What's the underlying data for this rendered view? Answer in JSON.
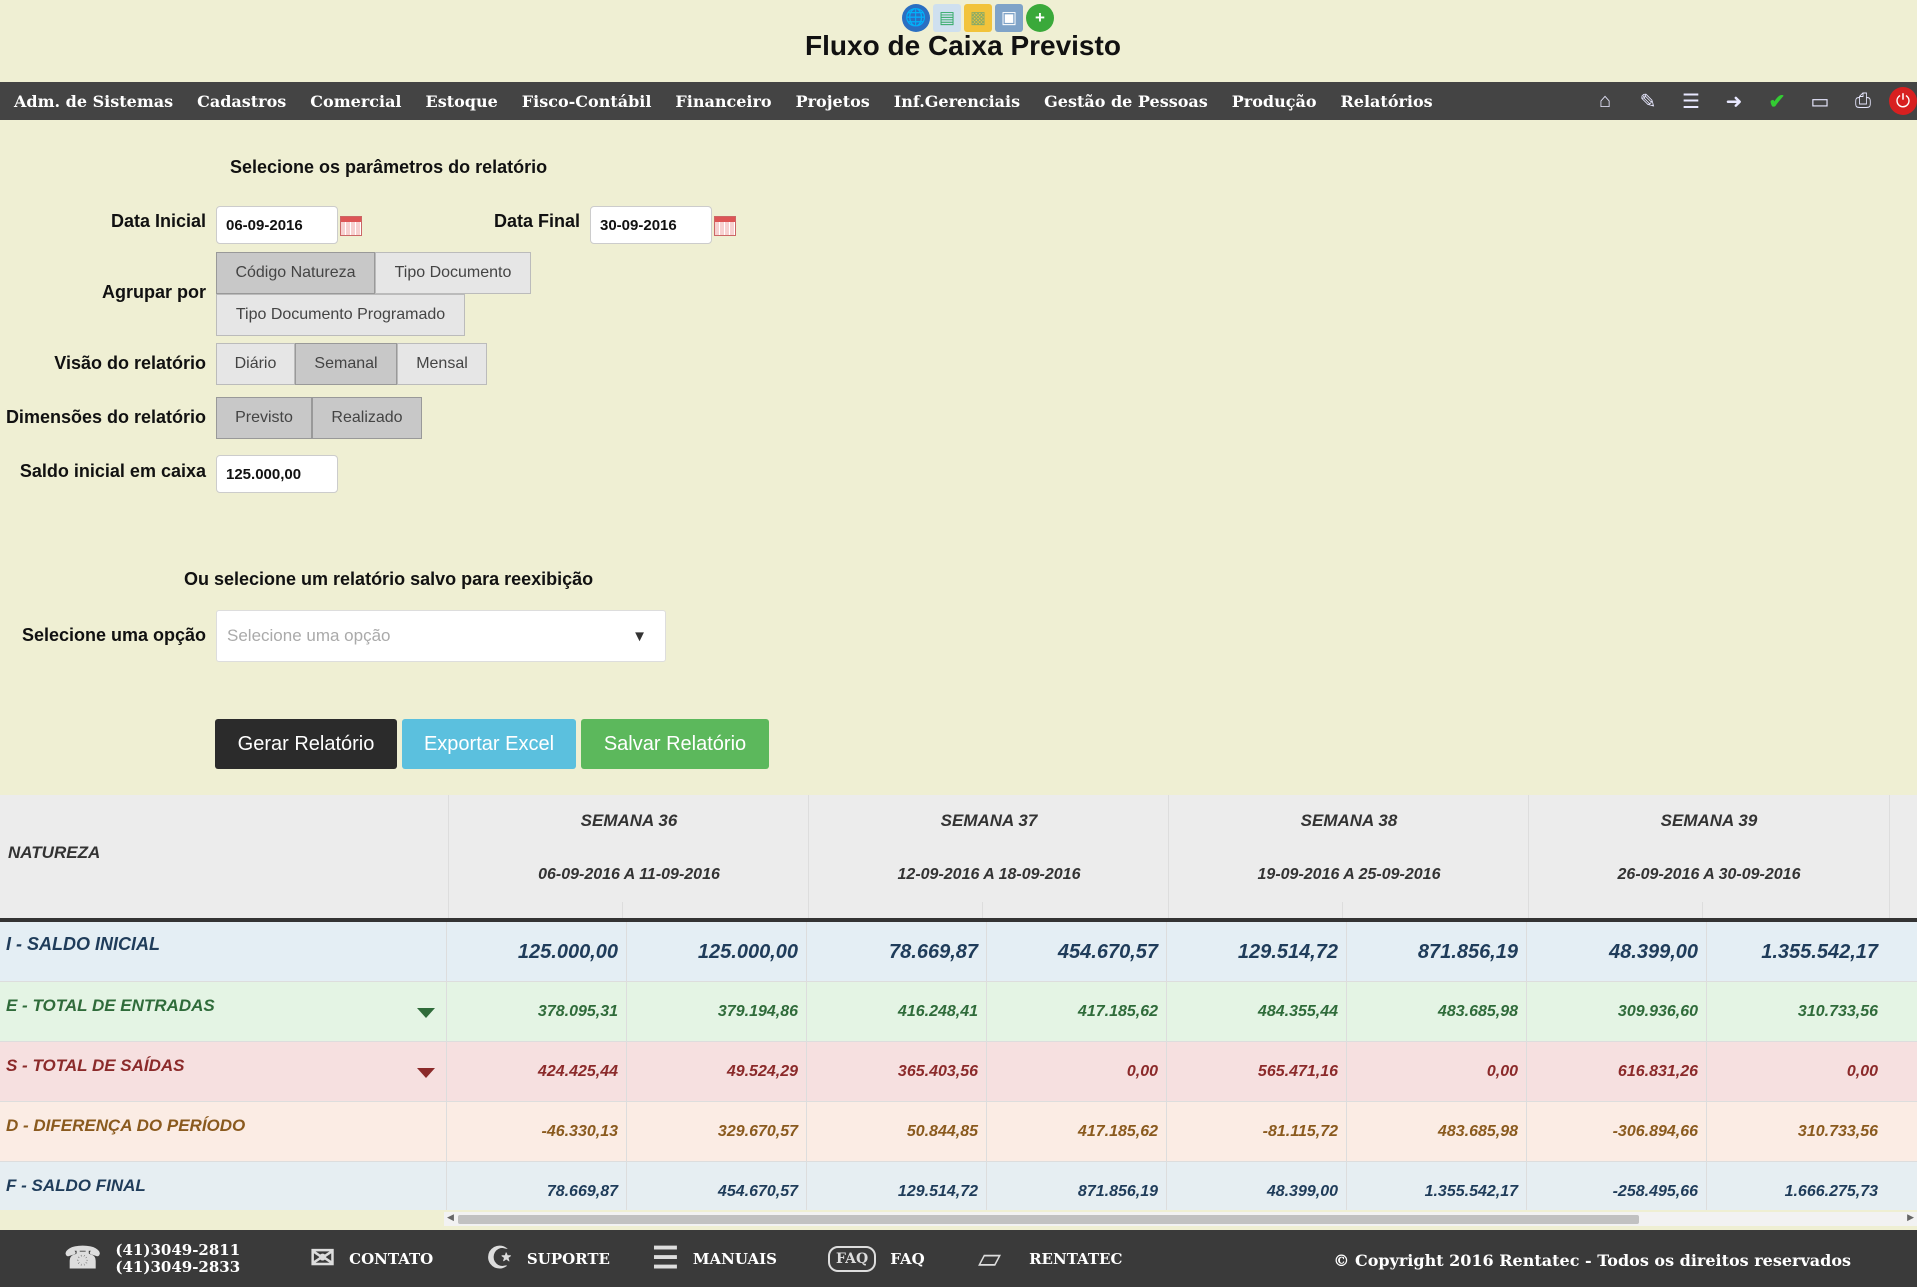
{
  "app": {
    "title": "Fluxo de Caixa Previsto",
    "top_icons": [
      "globe-icon",
      "card-icon",
      "folder-icon",
      "basket-icon",
      "add-icon"
    ]
  },
  "menu": {
    "items": [
      "Adm. de Sistemas",
      "Cadastros",
      "Comercial",
      "Estoque",
      "Fisco-Contábil",
      "Financeiro",
      "Projetos",
      "Inf.Gerenciais",
      "Gestão de Pessoas",
      "Produção",
      "Relatórios"
    ],
    "tools": [
      "home-icon",
      "edit-icon",
      "report-icon",
      "export-icon",
      "check-icon",
      "document-icon",
      "print-icon",
      "power-icon"
    ]
  },
  "form": {
    "section_title": "Selecione os parâmetros do relatório",
    "data_inicial_label": "Data Inicial",
    "data_inicial_value": "06-09-2016",
    "data_final_label": "Data Final",
    "data_final_value": "30-09-2016",
    "agrupar_label": "Agrupar por",
    "agrupar_options": [
      "Código Natureza",
      "Tipo Documento",
      "Tipo Documento Programado"
    ],
    "agrupar_selected": "Código Natureza",
    "visao_label": "Visão do relatório",
    "visao_options": [
      "Diário",
      "Semanal",
      "Mensal"
    ],
    "visao_selected": "Semanal",
    "dimensoes_label": "Dimensões do relatório",
    "dimensoes_options": [
      "Previsto",
      "Realizado"
    ],
    "saldo_label": "Saldo inicial em caixa",
    "saldo_value": "125.000,00",
    "saved_title": "Ou selecione um relatório salvo para reexibição",
    "select_label": "Selecione uma opção",
    "select_placeholder": "Selecione uma opção"
  },
  "buttons": {
    "gerar": "Gerar Relatório",
    "exportar": "Exportar Excel",
    "salvar": "Salvar Relatório"
  },
  "colors": {
    "gerar": "#2b2b2b",
    "exportar": "#5bc0de",
    "salvar": "#5cb85c"
  },
  "table": {
    "natureza_header": "NATUREZA",
    "weeks": [
      {
        "name": "SEMANA 36",
        "range": "06-09-2016 A 11-09-2016"
      },
      {
        "name": "SEMANA 37",
        "range": "12-09-2016 A 18-09-2016"
      },
      {
        "name": "SEMANA 38",
        "range": "19-09-2016 A 25-09-2016"
      },
      {
        "name": "SEMANA 39",
        "range": "26-09-2016 A 30-09-2016"
      }
    ],
    "rows": [
      {
        "name": "I - SALDO INICIAL",
        "values": [
          "125.000,00",
          "125.000,00",
          "78.669,87",
          "454.670,57",
          "129.514,72",
          "871.856,19",
          "48.399,00",
          "1.355.542,17"
        ]
      },
      {
        "name": "E - TOTAL DE ENTRADAS",
        "values": [
          "378.095,31",
          "379.194,86",
          "416.248,41",
          "417.185,62",
          "484.355,44",
          "483.685,98",
          "309.936,60",
          "310.733,56"
        ]
      },
      {
        "name": "S - TOTAL DE SAÍDAS",
        "values": [
          "424.425,44",
          "49.524,29",
          "365.403,56",
          "0,00",
          "565.471,16",
          "0,00",
          "616.831,26",
          "0,00"
        ]
      },
      {
        "name": "D - DIFERENÇA DO PERÍODO",
        "values": [
          "-46.330,13",
          "329.670,57",
          "50.844,85",
          "417.185,62",
          "-81.115,72",
          "483.685,98",
          "-306.894,66",
          "310.733,56"
        ]
      },
      {
        "name": "F - SALDO FINAL",
        "values": [
          "78.669,87",
          "454.670,57",
          "129.514,72",
          "871.856,19",
          "48.399,00",
          "1.355.542,17",
          "-258.495,66",
          "1.666.275,73"
        ]
      }
    ]
  },
  "footer": {
    "phone1": "(41)3049-2811",
    "phone2": "(41)3049-2833",
    "contato": "CONTATO",
    "suporte": "SUPORTE",
    "manuais": "MANUAIS",
    "faq": "FAQ",
    "rentatec": "RENTATEC",
    "copyright": "© Copyright 2016 Rentatec - Todos os direitos reservados"
  }
}
